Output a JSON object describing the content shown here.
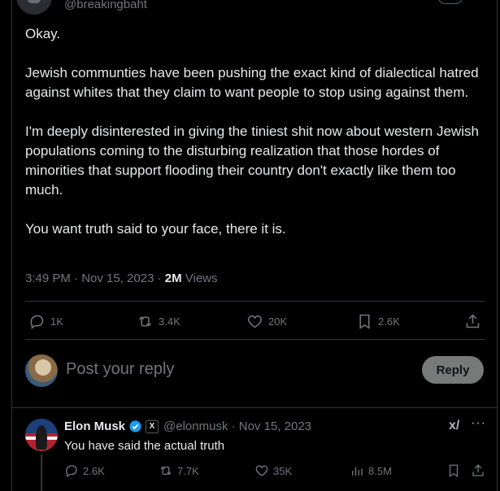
{
  "top": {
    "handle": "@breakingbaht"
  },
  "tweet": {
    "paragraphs": [
      "Okay.",
      "Jewish communties have been pushing the exact kind of dialectical hatred against whites that they claim to want people to stop using against them.",
      "I'm deeply disinterested in giving the tiniest shit now about western Jewish populations coming to the disturbing realization that those hordes of minorities that support flooding their country don't exactly like them too much.",
      "You want truth said to your face, there it is."
    ],
    "timestamp": "3:49 PM · Nov 15, 2023 · ",
    "views_count": "2M",
    "views_label": " Views",
    "stats": {
      "replies": "1K",
      "reposts": "3.4K",
      "likes": "20K",
      "bookmarks": "2.6K"
    }
  },
  "reply_box": {
    "placeholder": "Post your reply",
    "button_label": "Reply"
  },
  "reply_tweet": {
    "name": "Elon Musk",
    "x_badge": "X",
    "handle_date": "@elonmusk · Nov 15, 2023",
    "text": "You have said the actual truth",
    "stats": {
      "replies": "2.6K",
      "reposts": "7.7K",
      "likes": "35K",
      "views": "8.5M"
    }
  },
  "colors": {
    "background": "#000000",
    "text": "#e7e9ea",
    "muted": "#71767b",
    "verified": "#1d9bf0"
  }
}
